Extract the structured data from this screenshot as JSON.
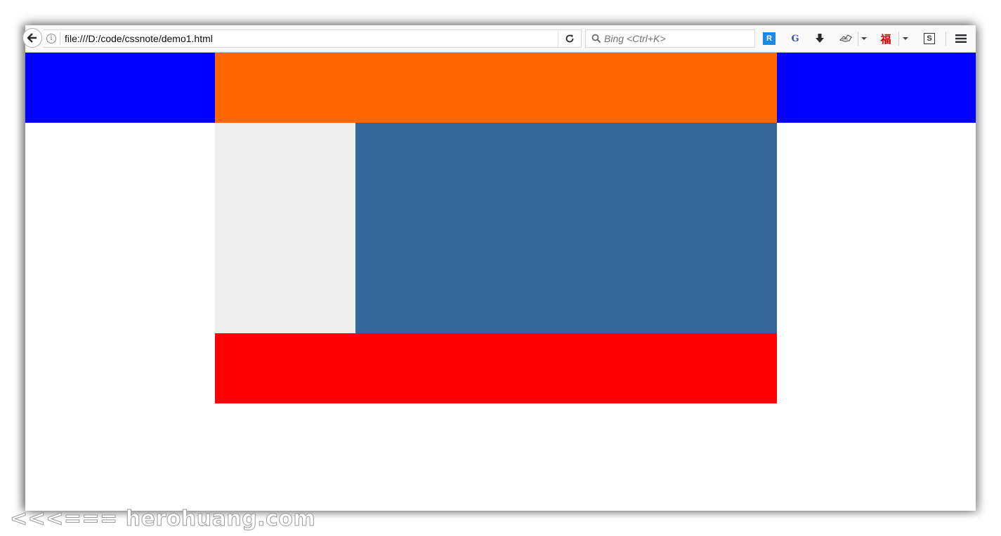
{
  "browser": {
    "url": "file:///D:/code/cssnote/demo1.html",
    "search_placeholder": "Bing <Ctrl+K>",
    "extensions": {
      "r_label": "R",
      "g_label": "G",
      "fu_label": "福",
      "s_label": "S"
    },
    "icons": [
      "back-arrow-icon",
      "info-icon",
      "reload-icon",
      "search-icon",
      "download-icon",
      "fox-icon",
      "menu-icon"
    ]
  },
  "page": {
    "colors": {
      "header_outer": "#0000ff",
      "header_inner": "#ff6600",
      "sidebar": "#eeeeee",
      "main": "#336699",
      "footer": "#ff0000"
    }
  },
  "watermark": {
    "text": "<<<=== herohuang.com"
  }
}
